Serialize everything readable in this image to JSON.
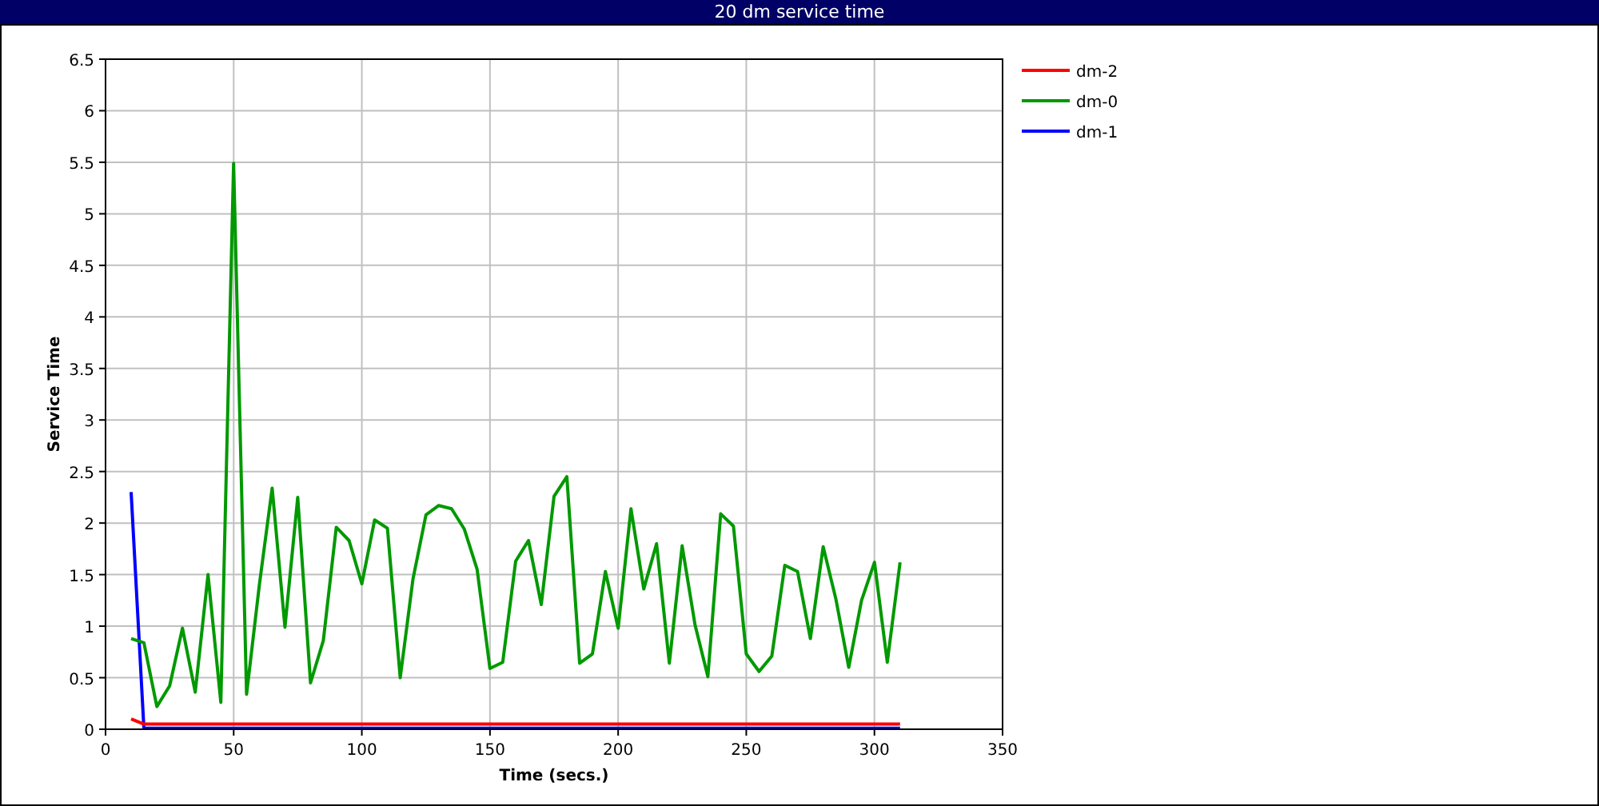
{
  "window": {
    "title": "20 dm service time"
  },
  "chart": {
    "chart_data": {
      "type": "line",
      "xlabel": "Time (secs.)",
      "ylabel": "Service Time",
      "x": [
        10,
        15,
        20,
        25,
        30,
        35,
        40,
        45,
        50,
        55,
        60,
        65,
        70,
        75,
        80,
        85,
        90,
        95,
        100,
        105,
        110,
        115,
        120,
        125,
        130,
        135,
        140,
        145,
        150,
        155,
        160,
        165,
        170,
        175,
        180,
        185,
        190,
        195,
        200,
        205,
        210,
        215,
        220,
        225,
        230,
        235,
        240,
        245,
        250,
        255,
        260,
        265,
        270,
        275,
        280,
        285,
        290,
        295,
        300,
        305,
        310
      ],
      "series": [
        {
          "name": "dm-2",
          "color": "#ff0000",
          "values": [
            0.1,
            0.05,
            0.05,
            0.05,
            0.05,
            0.05,
            0.05,
            0.05,
            0.05,
            0.05,
            0.05,
            0.05,
            0.05,
            0.05,
            0.05,
            0.05,
            0.05,
            0.05,
            0.05,
            0.05,
            0.05,
            0.05,
            0.05,
            0.05,
            0.05,
            0.05,
            0.05,
            0.05,
            0.05,
            0.05,
            0.05,
            0.05,
            0.05,
            0.05,
            0.05,
            0.05,
            0.05,
            0.05,
            0.05,
            0.05,
            0.05,
            0.05,
            0.05,
            0.05,
            0.05,
            0.05,
            0.05,
            0.05,
            0.05,
            0.05,
            0.05,
            0.05,
            0.05,
            0.05,
            0.05,
            0.05,
            0.05,
            0.05,
            0.05,
            0.05,
            0.05
          ]
        },
        {
          "name": "dm-0",
          "color": "#009900",
          "values": [
            0.88,
            0.84,
            0.22,
            0.42,
            0.98,
            0.36,
            1.5,
            0.26,
            5.49,
            0.34,
            1.4,
            2.34,
            0.99,
            2.25,
            0.45,
            0.86,
            1.96,
            1.83,
            1.41,
            2.03,
            1.95,
            0.5,
            1.46,
            2.08,
            2.17,
            2.14,
            1.94,
            1.55,
            0.59,
            0.65,
            1.63,
            1.83,
            1.21,
            2.26,
            2.45,
            0.64,
            0.73,
            1.53,
            0.98,
            2.14,
            1.36,
            1.8,
            0.64,
            1.78,
            1.01,
            0.51,
            2.09,
            1.97,
            0.73,
            0.56,
            0.71,
            1.59,
            1.53,
            0.88,
            1.77,
            1.26,
            0.6,
            1.25,
            1.62,
            0.65,
            1.62
          ]
        },
        {
          "name": "dm-1",
          "color": "#0000ff",
          "values": [
            2.3,
            0.01,
            0.01,
            0.01,
            0.01,
            0.01,
            0.01,
            0.01,
            0.01,
            0.01,
            0.01,
            0.01,
            0.01,
            0.01,
            0.01,
            0.01,
            0.01,
            0.01,
            0.01,
            0.01,
            0.01,
            0.01,
            0.01,
            0.01,
            0.01,
            0.01,
            0.01,
            0.01,
            0.01,
            0.01,
            0.01,
            0.01,
            0.01,
            0.01,
            0.01,
            0.01,
            0.01,
            0.01,
            0.01,
            0.01,
            0.01,
            0.01,
            0.01,
            0.01,
            0.01,
            0.01,
            0.01,
            0.01,
            0.01,
            0.01,
            0.01,
            0.01,
            0.01,
            0.01,
            0.01,
            0.01,
            0.01,
            0.01,
            0.01,
            0.01,
            0.01
          ]
        }
      ],
      "grid": true,
      "legend": true,
      "xlim": [
        0,
        350
      ],
      "ylim": [
        0,
        6.5
      ],
      "xticks": [
        0,
        50,
        100,
        150,
        200,
        250,
        300,
        350
      ],
      "yticks": [
        0,
        0.5,
        1,
        1.5,
        2,
        2.5,
        3,
        3.5,
        4,
        4.5,
        5,
        5.5,
        6,
        6.5
      ]
    }
  }
}
